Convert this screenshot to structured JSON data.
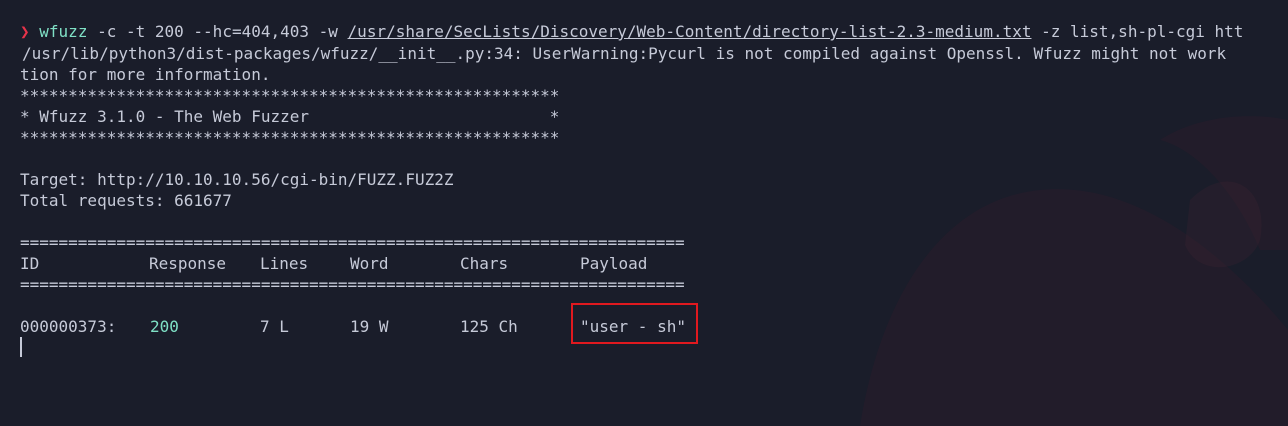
{
  "prompt_symbol": "❯",
  "command": {
    "program": "wfuzz",
    "args_before_path": " -c -t 200 --hc=404,403 -w ",
    "wordlist_path": "/usr/share/SecLists/Discovery/Web-Content/directory-list-2.3-medium.txt",
    "args_after_path": " -z list,sh-pl-cgi htt"
  },
  "warning_line_1": "/usr/lib/python3/dist-packages/wfuzz/__init__.py:34: UserWarning:Pycurl is not compiled against Openssl. Wfuzz might not work",
  "warning_line_2": "tion for more information.",
  "banner": {
    "border": "********************************************************",
    "title": "* Wfuzz 3.1.0 - The Web Fuzzer                         *"
  },
  "target_line": "Target: http://10.10.10.56/cgi-bin/FUZZ.FUZ2Z",
  "total_requests_line": "Total requests: 661677",
  "separator": "=====================================================================",
  "table": {
    "headers": [
      "ID",
      "Response",
      "Lines",
      "Word",
      "Chars",
      "Payload"
    ],
    "rows": [
      [
        "000000373:",
        "200",
        "7 L",
        "19 W",
        "125 Ch",
        "\"user - sh\""
      ]
    ]
  },
  "colors": {
    "background": "#1a1d2a",
    "text": "#c6cad8",
    "prompt": "#e8334a",
    "accent": "#7fe0c5",
    "highlight_border": "#e0191f"
  }
}
